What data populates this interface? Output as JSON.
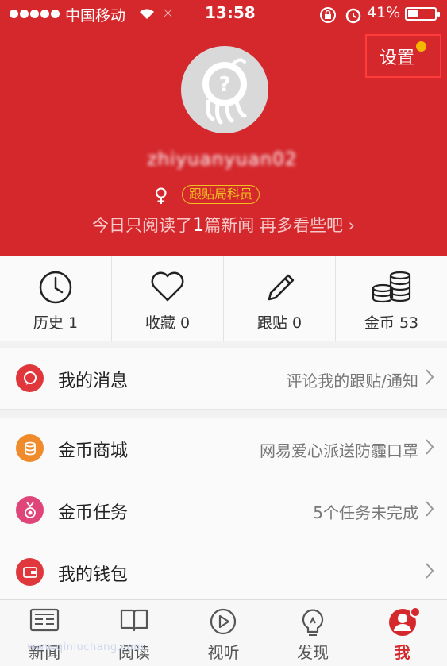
{
  "status_bar": {
    "carrier": "中国移动",
    "time": "13:58",
    "battery_percent": "41%",
    "battery_level": 0.41
  },
  "header": {
    "settings_label": "设置",
    "username": "zhiyuanyuan02",
    "gender": "♀",
    "rank": "跟贴局科员",
    "reading_tip_prefix": "今日只阅读了",
    "reading_count": "1",
    "reading_tip_suffix": "篇新闻  再多看些吧 ›"
  },
  "stats": [
    {
      "label": "历史",
      "value": "1",
      "icon": "clock-icon"
    },
    {
      "label": "收藏",
      "value": "0",
      "icon": "heart-icon"
    },
    {
      "label": "跟贴",
      "value": "0",
      "icon": "pencil-icon"
    },
    {
      "label": "金币",
      "value": "53",
      "icon": "coins-icon"
    }
  ],
  "menu": [
    {
      "label": "我的消息",
      "detail": "评论我的跟贴/通知",
      "icon": "message-icon",
      "color": "#e0373c"
    },
    {
      "label": "金币商城",
      "detail": "网易爱心派送防霾口罩",
      "icon": "coin-store-icon",
      "color": "#f08b2c"
    },
    {
      "label": "金币任务",
      "detail": "5个任务未完成",
      "icon": "medal-icon",
      "color": "#e0457a"
    },
    {
      "label": "我的钱包",
      "detail": "",
      "icon": "wallet-icon",
      "color": "#e0373c"
    }
  ],
  "tabs": [
    {
      "label": "新闻",
      "icon": "news-icon"
    },
    {
      "label": "阅读",
      "icon": "book-icon"
    },
    {
      "label": "视听",
      "icon": "play-icon"
    },
    {
      "label": "发现",
      "icon": "bulb-icon"
    },
    {
      "label": "我",
      "icon": "me-icon"
    }
  ],
  "watermark": "www.qiniuchang.com",
  "colors": {
    "brand_red": "#d4282d",
    "badge_gold": "#f0c020",
    "settings_dot": "#f5b700"
  }
}
